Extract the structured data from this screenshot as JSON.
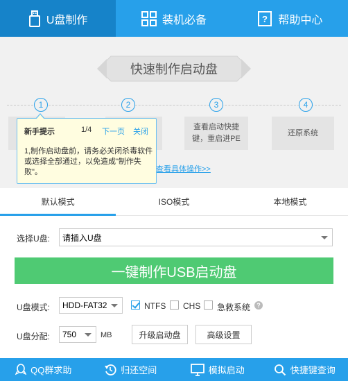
{
  "topnav": {
    "tabs": [
      {
        "label": "U盘制作",
        "icon": "usb-icon"
      },
      {
        "label": "装机必备",
        "icon": "grid-icon"
      },
      {
        "label": "帮助中心",
        "icon": "help-doc-icon"
      }
    ]
  },
  "banner": {
    "title": "快速制作启动盘",
    "steps": [
      {
        "num": "1",
        "text": ""
      },
      {
        "num": "2",
        "text": ""
      },
      {
        "num": "3",
        "text": "查看启动快捷键，重启进PE"
      },
      {
        "num": "4",
        "text": "还原系统"
      }
    ],
    "detail_link": "查看具体操作>>"
  },
  "tooltip": {
    "title": "新手提示",
    "page": "1/4",
    "next": "下一页",
    "close": "关闭",
    "body": "1,制作启动盘前，请务必关闭杀毒软件或选择全部通过，以免造成\"制作失败\"。"
  },
  "modes": [
    "默认模式",
    "ISO模式",
    "本地模式"
  ],
  "form": {
    "select_label": "选择U盘:",
    "select_value": "请插入U盘",
    "make_button": "一键制作USB启动盘",
    "mode_label": "U盘模式:",
    "mode_value": "HDD-FAT32",
    "ntfs": "NTFS",
    "chs": "CHS",
    "rescue": "急救系统",
    "partition_label": "U盘分配:",
    "partition_value": "750",
    "partition_unit": "MB",
    "upgrade_button": "升级启动盘",
    "advanced_button": "高级设置"
  },
  "footer": [
    {
      "label": "QQ群求助",
      "icon": "qq-icon"
    },
    {
      "label": "归还空间",
      "icon": "restore-icon"
    },
    {
      "label": "模拟启动",
      "icon": "monitor-icon"
    },
    {
      "label": "快捷键查询",
      "icon": "search-icon"
    }
  ],
  "colors": {
    "accent": "#27a0ea",
    "accent_dark": "#1683c9",
    "green": "#4fca73"
  }
}
